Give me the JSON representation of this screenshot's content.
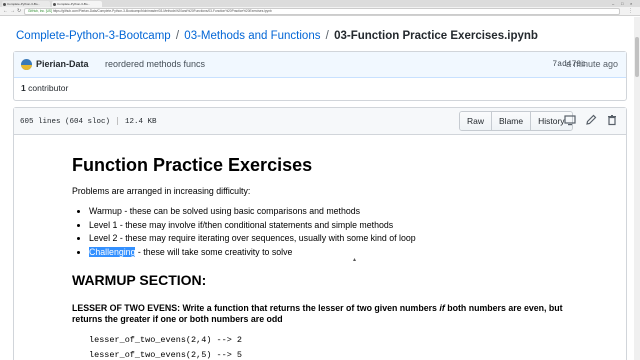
{
  "browser": {
    "tabs": [
      {
        "label": "Complete-Python-3-Bo..."
      },
      {
        "label": "Complete-Python-3-Bo..."
      }
    ],
    "window_controls": [
      "–",
      "□",
      "×"
    ],
    "url_secure_label": "GitHub, Inc. [US]",
    "url": "https://github.com/Pierian-Data/Complete-Python-3-Bootcamp/blob/master/03-Methods%20and%20Functions/03-Function%20Practice%20Exercises.ipynb"
  },
  "breadcrumb": {
    "repo": "Complete-Python-3-Bootcamp",
    "sep1": "/",
    "folder": "03-Methods and Functions",
    "sep2": "/",
    "file": "03-Function Practice Exercises.ipynb"
  },
  "commit": {
    "author": "Pierian-Data",
    "message": "reordered methods funcs",
    "sha": "7ad479c",
    "time": "a minute ago",
    "contributors_count": "1",
    "contributors_label": "contributor"
  },
  "file": {
    "lines": "605 lines (604 sloc)",
    "size": "12.4 KB",
    "buttons": {
      "raw": "Raw",
      "blame": "Blame",
      "history": "History"
    }
  },
  "notebook": {
    "title": "Function Practice Exercises",
    "intro": "Problems are arranged in increasing difficulty:",
    "levels": [
      {
        "name": "Warmup",
        "desc": " - these can be solved using basic comparisons and methods"
      },
      {
        "name": "Level 1",
        "desc": " - these may involve if/then conditional statements and simple methods"
      },
      {
        "name": "Level 2",
        "desc": " - these may require iterating over sequences, usually with some kind of loop"
      },
      {
        "name": "Challenging",
        "desc": " - these will take some creativity to solve"
      }
    ],
    "section": "WARMUP SECTION:",
    "problem_part1": "LESSER OF TWO EVENS: Write a function that returns the lesser of two given numbers ",
    "problem_if": "if",
    "problem_part2": " both numbers are even, but returns the greater if one or both numbers are odd",
    "examples": [
      "lesser_of_two_evens(2,4) --> 2",
      "lesser_of_two_evens(2,5) --> 5"
    ]
  }
}
